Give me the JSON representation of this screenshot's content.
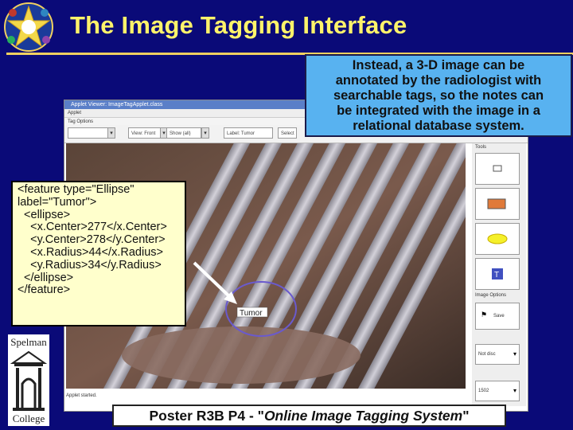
{
  "slide": {
    "title": "The Image Tagging Interface"
  },
  "callout_top": {
    "text": "Instead, a 3-D image can be\nannotated by the radiologist with\nsearchable tags, so the notes can\nbe integrated with the image in a\nrelational database system."
  },
  "callout_xml": {
    "text": "<feature type=\"Ellipse\"\nlabel=\"Tumor\">\n  <ellipse>\n    <x.Center>277</x.Center>\n    <y.Center>278</y.Center>\n    <x.Radius>44</x.Radius>\n    <y.Radius>34</y.Radius>\n  </ellipse>\n</feature>"
  },
  "applet": {
    "window_title": "Applet Viewer: ImageTagApplet.class",
    "menu": "Applet",
    "tag_options_label": "Tag Options",
    "toolbar": {
      "view_label": "View: Front",
      "show_label": "Show (all)",
      "label_field": "Label: Tumor",
      "extra_field": "Select"
    },
    "tumor_tag": "Tumor",
    "tools_label": "Tools",
    "image_options_label": "Image Options",
    "save_label": "Save",
    "select_1": "Not disc",
    "select_2": "1502",
    "status": "Applet started."
  },
  "logo": {
    "institution": "Spelman",
    "institution_line2": "College"
  },
  "footer": {
    "prefix": "Poster R3B P4 - \"",
    "title": "Online Image Tagging System",
    "suffix": "\""
  },
  "colors": {
    "background": "#0a0a78",
    "title": "#fff36a",
    "callout_top": "#58b2f0",
    "callout_xml": "#ffffcc",
    "ellipse": "#6a5acd"
  }
}
